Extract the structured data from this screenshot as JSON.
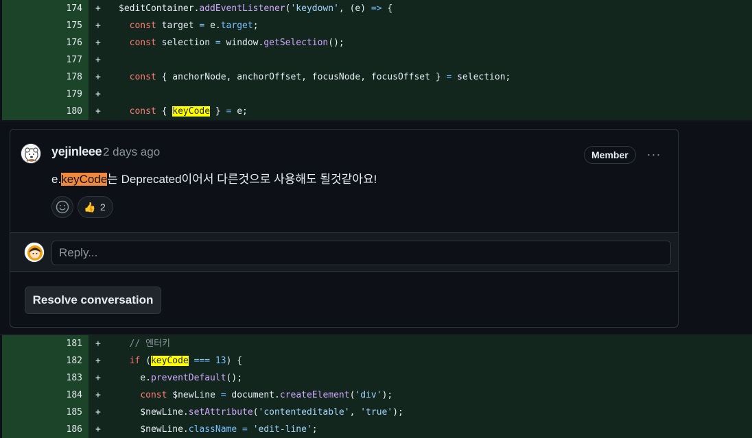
{
  "diff_top": [
    {
      "num": "174",
      "sign": "+",
      "tokens": [
        [
          "",
          "$editContainer."
        ],
        [
          "fn",
          "addEventListener"
        ],
        [
          "",
          "("
        ],
        [
          "str",
          "'keydown'"
        ],
        [
          "",
          ", (e) "
        ],
        [
          "op",
          "=>"
        ],
        [
          "",
          " {"
        ]
      ]
    },
    {
      "num": "175",
      "sign": "+",
      "tokens": [
        [
          "",
          "  "
        ],
        [
          "kw",
          "const"
        ],
        [
          "",
          " target "
        ],
        [
          "op",
          "="
        ],
        [
          "",
          " e."
        ],
        [
          "prop",
          "target"
        ],
        [
          "",
          ";"
        ]
      ]
    },
    {
      "num": "176",
      "sign": "+",
      "tokens": [
        [
          "",
          "  "
        ],
        [
          "kw",
          "const"
        ],
        [
          "",
          " selection "
        ],
        [
          "op",
          "="
        ],
        [
          "",
          " window."
        ],
        [
          "fn",
          "getSelection"
        ],
        [
          "",
          "();"
        ]
      ]
    },
    {
      "num": "177",
      "sign": "+",
      "tokens": []
    },
    {
      "num": "178",
      "sign": "+",
      "tokens": [
        [
          "",
          "  "
        ],
        [
          "kw",
          "const"
        ],
        [
          "",
          " { anchorNode, anchorOffset, focusNode, focusOffset } "
        ],
        [
          "op",
          "="
        ],
        [
          "",
          " selection;"
        ]
      ]
    },
    {
      "num": "179",
      "sign": "+",
      "tokens": []
    },
    {
      "num": "180",
      "sign": "+",
      "tokens": [
        [
          "",
          "  "
        ],
        [
          "kw",
          "const"
        ],
        [
          "",
          " { "
        ],
        [
          "hl",
          "keyCode"
        ],
        [
          "",
          " } "
        ],
        [
          "op",
          "="
        ],
        [
          "",
          " e;"
        ]
      ]
    }
  ],
  "diff_bottom": [
    {
      "num": "181",
      "sign": "+",
      "tokens": [
        [
          "",
          "  "
        ],
        [
          "cm",
          "// 엔터키"
        ]
      ]
    },
    {
      "num": "182",
      "sign": "+",
      "tokens": [
        [
          "",
          "  "
        ],
        [
          "kw",
          "if"
        ],
        [
          "",
          " ("
        ],
        [
          "hl",
          "keyCode"
        ],
        [
          "",
          " "
        ],
        [
          "op",
          "==="
        ],
        [
          "",
          " "
        ],
        [
          "num-lit",
          "13"
        ],
        [
          "",
          ") {"
        ]
      ]
    },
    {
      "num": "183",
      "sign": "+",
      "tokens": [
        [
          "",
          "    e."
        ],
        [
          "fn",
          "preventDefault"
        ],
        [
          "",
          "();"
        ]
      ]
    },
    {
      "num": "184",
      "sign": "+",
      "tokens": [
        [
          "",
          "    "
        ],
        [
          "kw",
          "const"
        ],
        [
          "",
          " $newLine "
        ],
        [
          "op",
          "="
        ],
        [
          "",
          " document."
        ],
        [
          "fn",
          "createElement"
        ],
        [
          "",
          "("
        ],
        [
          "str",
          "'div'"
        ],
        [
          "",
          ");"
        ]
      ]
    },
    {
      "num": "185",
      "sign": "+",
      "tokens": [
        [
          "",
          "    $newLine."
        ],
        [
          "fn",
          "setAttribute"
        ],
        [
          "",
          "("
        ],
        [
          "str",
          "'contenteditable'"
        ],
        [
          "",
          ", "
        ],
        [
          "str",
          "'true'"
        ],
        [
          "",
          ");"
        ]
      ]
    },
    {
      "num": "186",
      "sign": "+",
      "tokens": [
        [
          "",
          "    $newLine."
        ],
        [
          "prop",
          "className"
        ],
        [
          "",
          " "
        ],
        [
          "op",
          "="
        ],
        [
          "",
          " "
        ],
        [
          "str",
          "'edit-line'"
        ],
        [
          "",
          ";"
        ]
      ]
    }
  ],
  "comment": {
    "author": "yejinleee",
    "time": "2 days ago",
    "badge": "Member",
    "more_label": "···",
    "body_prefix": "e.",
    "body_highlight": "keyCode",
    "body_suffix": "는 Deprecated이어서 다른것으로 사용해도 될것같아요!",
    "reaction_emoji": "👍",
    "reaction_count": "2"
  },
  "reply": {
    "placeholder": "Reply..."
  },
  "resolve_label": "Resolve conversation",
  "colors": {
    "gutter_added": "#1c4428",
    "code_added": "#12261e",
    "highlight": "#ffff00",
    "mention_highlight": "#f0883e"
  }
}
